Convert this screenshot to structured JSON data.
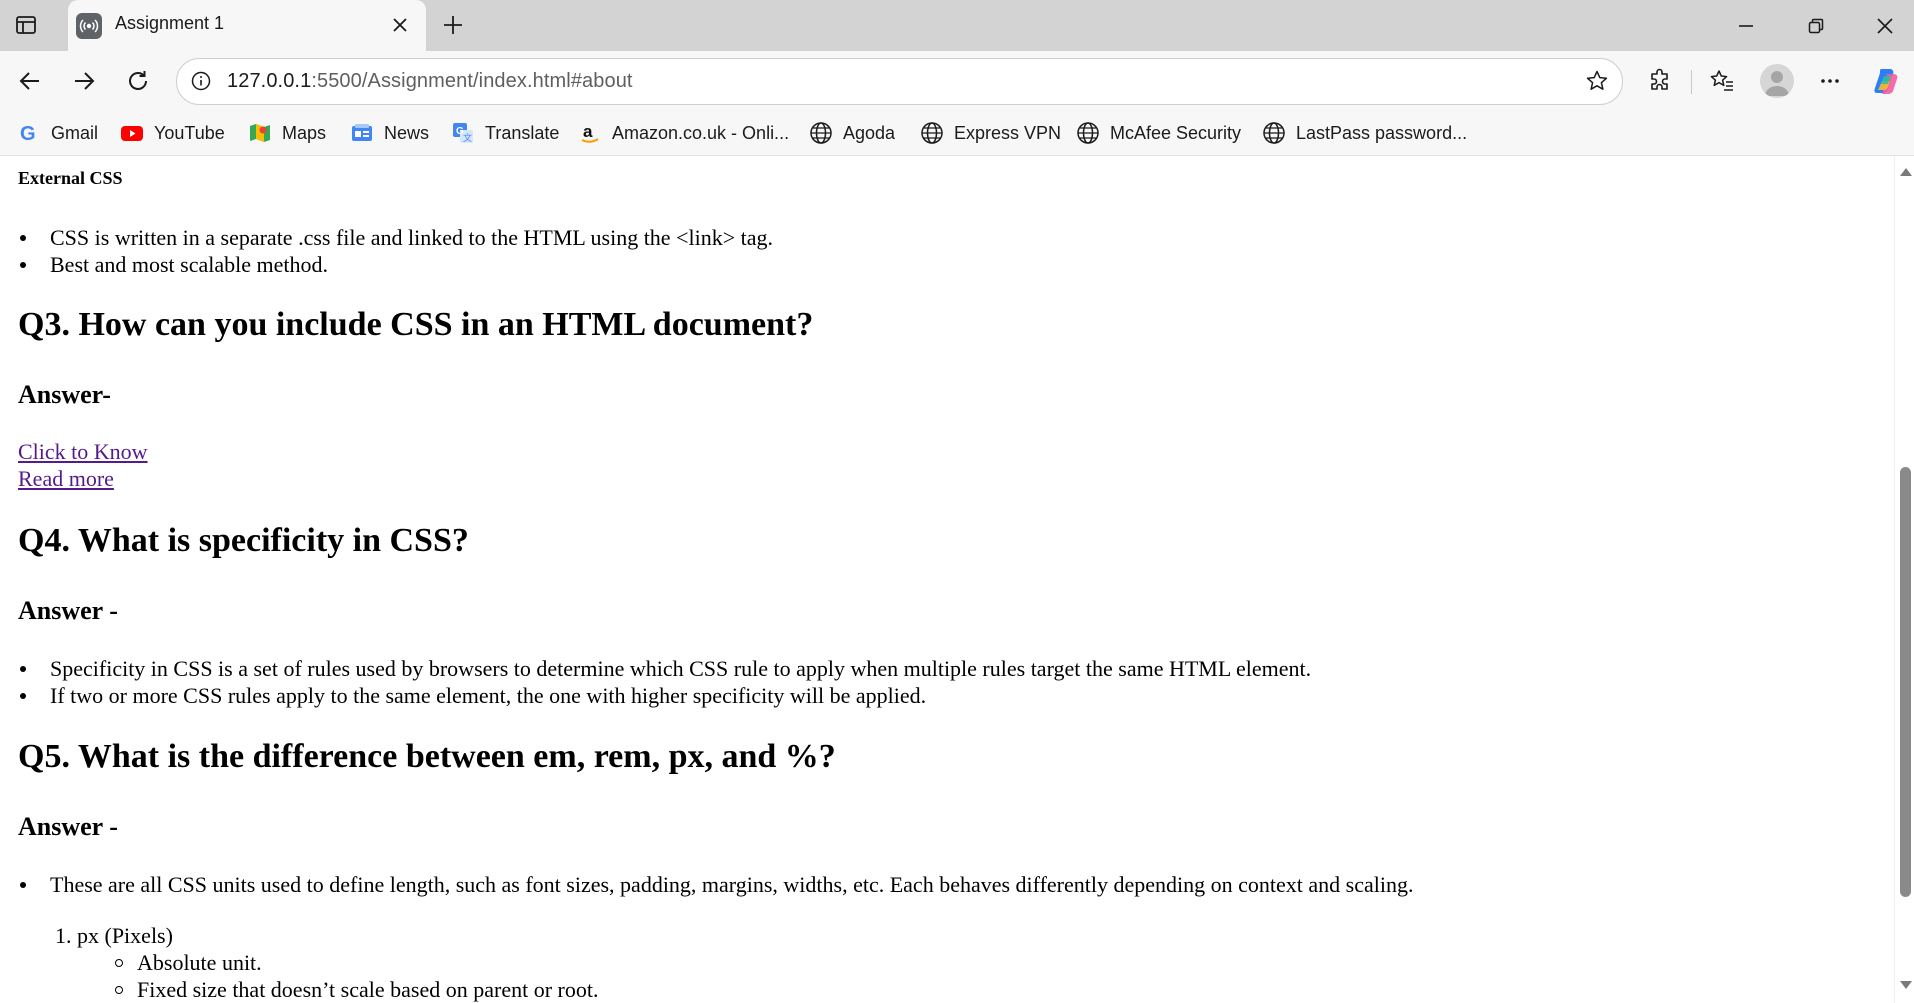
{
  "browser": {
    "tab": {
      "title": "Assignment 1",
      "favicon": "broadcast-icon"
    },
    "address": {
      "host": "127.0.0.1",
      "rest": ":5500/Assignment/index.html#about"
    },
    "bookmarks": [
      {
        "label": "Gmail",
        "icon": "gmail-icon"
      },
      {
        "label": "YouTube",
        "icon": "youtube-icon"
      },
      {
        "label": "Maps",
        "icon": "maps-icon"
      },
      {
        "label": "News",
        "icon": "news-icon"
      },
      {
        "label": "Translate",
        "icon": "translate-icon"
      },
      {
        "label": "Amazon.co.uk - Onli...",
        "icon": "amazon-icon"
      },
      {
        "label": "Agoda",
        "icon": "globe-icon"
      },
      {
        "label": "Express VPN",
        "icon": "globe-icon"
      },
      {
        "label": "McAfee Security",
        "icon": "globe-icon"
      },
      {
        "label": "LastPass password...",
        "icon": "globe-icon"
      }
    ]
  },
  "page": {
    "external_css_heading": "External CSS",
    "external_css_points": [
      "CSS is written in a separate .css file and linked to the HTML using the <link> tag.",
      "Best and most scalable method."
    ],
    "q3": {
      "question": "Q3. How can you include CSS in an HTML document?",
      "answer_label": "Answer-",
      "link_know": "Click to Know",
      "link_more": "Read more"
    },
    "q4": {
      "question": "Q4. What is specificity in CSS?",
      "answer_label": "Answer -",
      "points": [
        "Specificity in CSS is a set of rules used by browsers to determine which CSS rule to apply when multiple rules target the same HTML element.",
        "If two or more CSS rules apply to the same element, the one with higher specificity will be applied."
      ]
    },
    "q5": {
      "question": "Q5. What is the difference between em, rem, px, and %?",
      "answer_label": "Answer -",
      "intro": "These are all CSS units used to define length, such as font sizes, padding, margins, widths, etc. Each behaves differently depending on context and scaling.",
      "item1": "1. px (Pixels)",
      "item1_points": [
        "Absolute unit.",
        "Fixed size that doesn’t scale based on parent or root."
      ]
    }
  }
}
